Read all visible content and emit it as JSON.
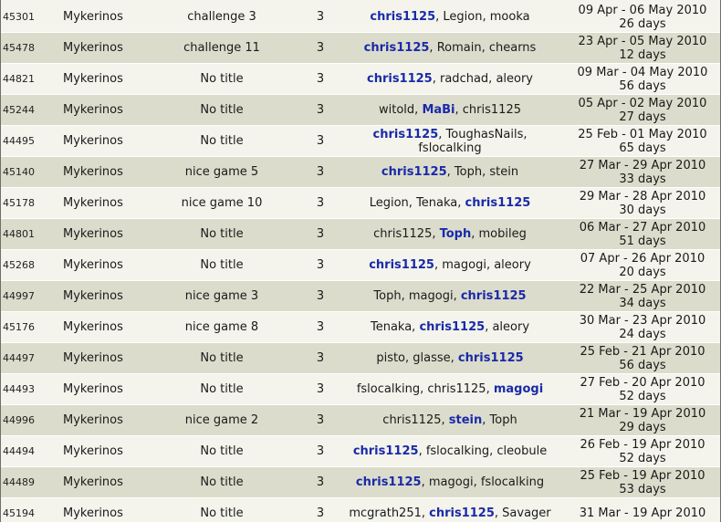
{
  "rows": [
    {
      "id": "45301",
      "map": "Mykerinos",
      "title": "challenge 3",
      "players": "3",
      "names": [
        {
          "n": "chris1125",
          "w": true
        },
        {
          "n": "Legion",
          "w": false
        },
        {
          "n": "mooka",
          "w": false
        }
      ],
      "range": "09 Apr - 06 May 2010",
      "days": "26 days"
    },
    {
      "id": "45478",
      "map": "Mykerinos",
      "title": "challenge 11",
      "players": "3",
      "names": [
        {
          "n": "chris1125",
          "w": true
        },
        {
          "n": "Romain",
          "w": false
        },
        {
          "n": "chearns",
          "w": false
        }
      ],
      "range": "23 Apr - 05 May 2010",
      "days": "12 days"
    },
    {
      "id": "44821",
      "map": "Mykerinos",
      "title": "No title",
      "players": "3",
      "names": [
        {
          "n": "chris1125",
          "w": true
        },
        {
          "n": "radchad",
          "w": false
        },
        {
          "n": "aleory",
          "w": false
        }
      ],
      "range": "09 Mar - 04 May 2010",
      "days": "56 days"
    },
    {
      "id": "45244",
      "map": "Mykerinos",
      "title": "No title",
      "players": "3",
      "names": [
        {
          "n": "witold",
          "w": false
        },
        {
          "n": "MaBi",
          "w": true
        },
        {
          "n": "chris1125",
          "w": false
        }
      ],
      "range": "05 Apr - 02 May 2010",
      "days": "27 days"
    },
    {
      "id": "44495",
      "map": "Mykerinos",
      "title": "No title",
      "players": "3",
      "names": [
        {
          "n": "chris1125",
          "w": true
        },
        {
          "n": "ToughasNails",
          "w": false
        },
        {
          "n": "fslocalking",
          "w": false
        }
      ],
      "range": "25 Feb - 01 May 2010",
      "days": "65 days"
    },
    {
      "id": "45140",
      "map": "Mykerinos",
      "title": "nice game 5",
      "players": "3",
      "names": [
        {
          "n": "chris1125",
          "w": true
        },
        {
          "n": "Toph",
          "w": false
        },
        {
          "n": "stein",
          "w": false
        }
      ],
      "range": "27 Mar - 29 Apr 2010",
      "days": "33 days"
    },
    {
      "id": "45178",
      "map": "Mykerinos",
      "title": "nice game 10",
      "players": "3",
      "names": [
        {
          "n": "Legion",
          "w": false
        },
        {
          "n": "Tenaka",
          "w": false
        },
        {
          "n": "chris1125",
          "w": true
        }
      ],
      "range": "29 Mar - 28 Apr 2010",
      "days": "30 days"
    },
    {
      "id": "44801",
      "map": "Mykerinos",
      "title": "No title",
      "players": "3",
      "names": [
        {
          "n": "chris1125",
          "w": false
        },
        {
          "n": "Toph",
          "w": true
        },
        {
          "n": "mobileg",
          "w": false
        }
      ],
      "range": "06 Mar - 27 Apr 2010",
      "days": "51 days"
    },
    {
      "id": "45268",
      "map": "Mykerinos",
      "title": "No title",
      "players": "3",
      "names": [
        {
          "n": "chris1125",
          "w": true
        },
        {
          "n": "magogi",
          "w": false
        },
        {
          "n": "aleory",
          "w": false
        }
      ],
      "range": "07 Apr - 26 Apr 2010",
      "days": "20 days"
    },
    {
      "id": "44997",
      "map": "Mykerinos",
      "title": "nice game 3",
      "players": "3",
      "names": [
        {
          "n": "Toph",
          "w": false
        },
        {
          "n": "magogi",
          "w": false
        },
        {
          "n": "chris1125",
          "w": true
        }
      ],
      "range": "22 Mar - 25 Apr 2010",
      "days": "34 days"
    },
    {
      "id": "45176",
      "map": "Mykerinos",
      "title": "nice game 8",
      "players": "3",
      "names": [
        {
          "n": "Tenaka",
          "w": false
        },
        {
          "n": "chris1125",
          "w": true
        },
        {
          "n": "aleory",
          "w": false
        }
      ],
      "range": "30 Mar - 23 Apr 2010",
      "days": "24 days"
    },
    {
      "id": "44497",
      "map": "Mykerinos",
      "title": "No title",
      "players": "3",
      "names": [
        {
          "n": "pisto",
          "w": false
        },
        {
          "n": "glasse",
          "w": false
        },
        {
          "n": "chris1125",
          "w": true
        }
      ],
      "range": "25 Feb - 21 Apr 2010",
      "days": "56 days"
    },
    {
      "id": "44493",
      "map": "Mykerinos",
      "title": "No title",
      "players": "3",
      "names": [
        {
          "n": "fslocalking",
          "w": false
        },
        {
          "n": "chris1125",
          "w": false
        },
        {
          "n": "magogi",
          "w": true
        }
      ],
      "range": "27 Feb - 20 Apr 2010",
      "days": "52 days"
    },
    {
      "id": "44996",
      "map": "Mykerinos",
      "title": "nice game 2",
      "players": "3",
      "names": [
        {
          "n": "chris1125",
          "w": false
        },
        {
          "n": "stein",
          "w": true
        },
        {
          "n": "Toph",
          "w": false
        }
      ],
      "range": "21 Mar - 19 Apr 2010",
      "days": "29 days"
    },
    {
      "id": "44494",
      "map": "Mykerinos",
      "title": "No title",
      "players": "3",
      "names": [
        {
          "n": "chris1125",
          "w": true
        },
        {
          "n": "fslocalking",
          "w": false
        },
        {
          "n": "cleobule",
          "w": false
        }
      ],
      "range": "26 Feb - 19 Apr 2010",
      "days": "52 days"
    },
    {
      "id": "44489",
      "map": "Mykerinos",
      "title": "No title",
      "players": "3",
      "names": [
        {
          "n": "chris1125",
          "w": true
        },
        {
          "n": "magogi",
          "w": false
        },
        {
          "n": "fslocalking",
          "w": false
        }
      ],
      "range": "25 Feb - 19 Apr 2010",
      "days": "53 days"
    },
    {
      "id": "45194",
      "map": "Mykerinos",
      "title": "No title",
      "players": "3",
      "names": [
        {
          "n": "mcgrath251",
          "w": false
        },
        {
          "n": "chris1125",
          "w": true
        },
        {
          "n": "Savager",
          "w": false
        }
      ],
      "range": "31 Mar - 19 Apr 2010",
      "days": ""
    }
  ],
  "colors": {
    "winner": "#1a2aa8",
    "row_light": "#f4f4ec",
    "row_dark": "#dcdccc"
  }
}
